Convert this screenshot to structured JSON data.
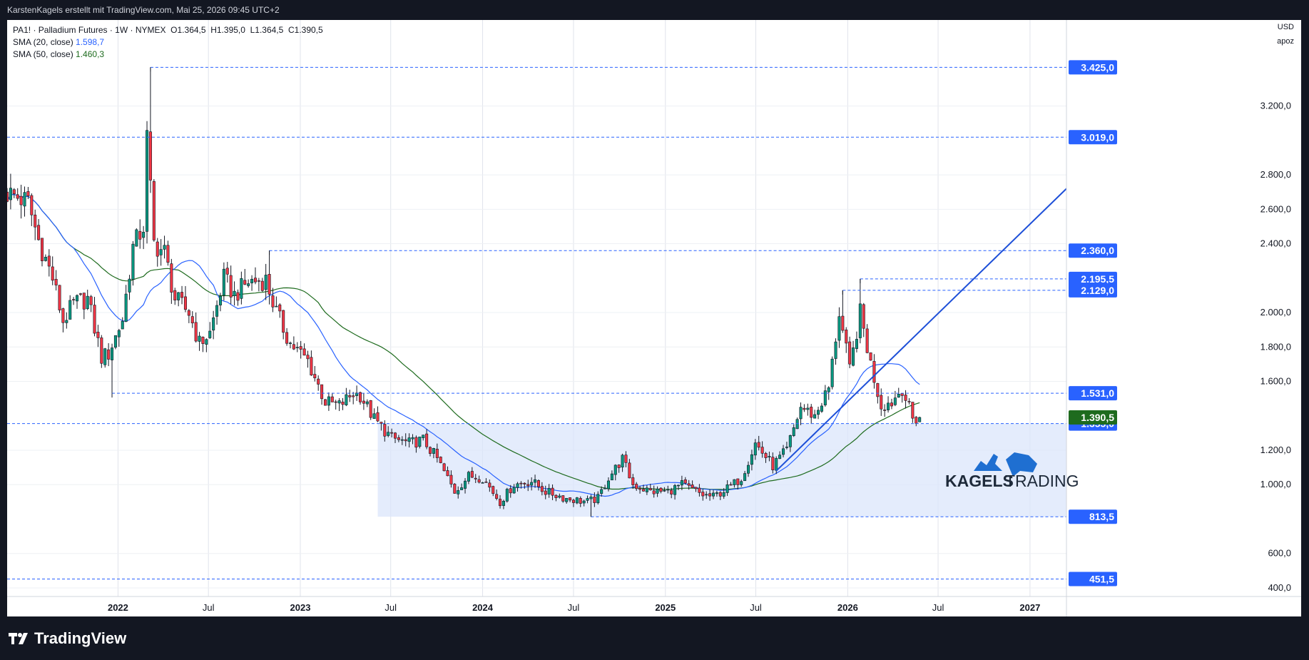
{
  "header": {
    "attribution": "KarstenKagels erstellt mit TradingView.com, Mai 25, 2026 09:45 UTC+2"
  },
  "legend": {
    "title": "PA1! · Palladium Futures · 1W · NYMEX",
    "open": "O1.364,5",
    "high": "H1.395,0",
    "low": "L1.364,5",
    "close": "C1.390,5",
    "sma20_label": "SMA (20, close)",
    "sma20_value": "1.598,7",
    "sma50_label": "SMA (50, close)",
    "sma50_value": "1.460,3"
  },
  "axis_meta": {
    "currency": "USD",
    "mode": "apoz"
  },
  "footer": {
    "brand": "TradingView"
  },
  "watermark": {
    "text1": "KAGELS",
    "text2": "TRADING"
  },
  "colors": {
    "up": "#089981",
    "down": "#f23645",
    "sma20": "#2962ff",
    "sma50": "#1e6b1e",
    "level_line": "#2962ff",
    "zone_fill": "#dbe6fb",
    "badge": "#2962ff",
    "close_badge": "#1e6b1e"
  },
  "chart_data": {
    "type": "candlestick",
    "symbol": "PA1!",
    "timeframe": "1W",
    "x_ticks": [
      {
        "label": "2022",
        "date": "2022-01-01",
        "bold": true
      },
      {
        "label": "Jul",
        "date": "2022-07-01",
        "bold": false
      },
      {
        "label": "2023",
        "date": "2023-01-01",
        "bold": true
      },
      {
        "label": "Jul",
        "date": "2023-07-01",
        "bold": false
      },
      {
        "label": "2024",
        "date": "2024-01-01",
        "bold": true
      },
      {
        "label": "Jul",
        "date": "2024-07-01",
        "bold": false
      },
      {
        "label": "2025",
        "date": "2025-01-01",
        "bold": true
      },
      {
        "label": "Jul",
        "date": "2025-07-01",
        "bold": false
      },
      {
        "label": "2026",
        "date": "2026-01-01",
        "bold": true
      },
      {
        "label": "Jul",
        "date": "2026-07-01",
        "bold": false
      },
      {
        "label": "2027",
        "date": "2027-01-01",
        "bold": true
      }
    ],
    "x_range": [
      "2021-05-24",
      "2027-03-15"
    ],
    "y_ticks": [
      {
        "label": "3.200,0",
        "value": 3200
      },
      {
        "label": "2.800,0",
        "value": 2800
      },
      {
        "label": "2.600,0",
        "value": 2600
      },
      {
        "label": "2.400,0",
        "value": 2400
      },
      {
        "label": "2.000,0",
        "value": 2000
      },
      {
        "label": "1.800,0",
        "value": 1800
      },
      {
        "label": "1.600,0",
        "value": 1600
      },
      {
        "label": "1.200,0",
        "value": 1200
      },
      {
        "label": "1.000,0",
        "value": 1000
      },
      {
        "label": "600,0",
        "value": 600
      },
      {
        "label": "400,0",
        "value": 400
      }
    ],
    "y_range": [
      350,
      3700
    ],
    "levels": [
      {
        "label": "3.425,0",
        "value": 3425,
        "from": "2022-03-07"
      },
      {
        "label": "3.019,0",
        "value": 3019,
        "from": "2021-05-24"
      },
      {
        "label": "2.360,0",
        "value": 2360,
        "from": "2022-10-31"
      },
      {
        "label": "2.195,5",
        "value": 2195.5,
        "from": "2026-01-26"
      },
      {
        "label": "2.129,0",
        "value": 2129,
        "from": "2025-12-22"
      },
      {
        "label": "1.531,0",
        "value": 1531,
        "from": "2021-12-20"
      },
      {
        "label": "1.355,0",
        "value": 1355,
        "from": "2021-05-24"
      },
      {
        "label": "813,5",
        "value": 813.5,
        "from": "2024-08-05"
      },
      {
        "label": "451,5",
        "value": 451.5,
        "from": "2021-05-24"
      }
    ],
    "current_price": {
      "label": "1.390,5",
      "value": 1390.5
    },
    "zone": {
      "from": "2023-06-05",
      "to": "2027-03-15",
      "low": 813.5,
      "high": 1355
    },
    "trendline": {
      "from_date": "2025-08-11",
      "from_value": 1080,
      "to_date": "2027-03-15",
      "to_value": 2720
    },
    "anchors": [
      [
        "2021-05-24",
        2700
      ],
      [
        "2021-06-14",
        2680
      ],
      [
        "2021-07-12",
        2640
      ],
      [
        "2021-08-02",
        2420
      ],
      [
        "2021-08-30",
        2200
      ],
      [
        "2021-09-20",
        1950
      ],
      [
        "2021-10-11",
        2050
      ],
      [
        "2021-11-08",
        2080
      ],
      [
        "2021-12-06",
        1740
      ],
      [
        "2021-12-20",
        1760
      ],
      [
        "2022-01-17",
        1960
      ],
      [
        "2022-02-07",
        2380
      ],
      [
        "2022-02-28",
        2500
      ],
      [
        "2022-03-07",
        3019
      ],
      [
        "2022-03-21",
        2400
      ],
      [
        "2022-04-11",
        2350
      ],
      [
        "2022-05-02",
        2080
      ],
      [
        "2022-05-30",
        2000
      ],
      [
        "2022-06-20",
        1820
      ],
      [
        "2022-07-11",
        1880
      ],
      [
        "2022-08-08",
        2200
      ],
      [
        "2022-08-29",
        2100
      ],
      [
        "2022-09-26",
        2180
      ],
      [
        "2022-10-31",
        2190
      ],
      [
        "2022-11-21",
        2000
      ],
      [
        "2022-12-19",
        1820
      ],
      [
        "2023-01-23",
        1720
      ],
      [
        "2023-02-27",
        1480
      ],
      [
        "2023-03-27",
        1460
      ],
      [
        "2023-04-24",
        1530
      ],
      [
        "2023-05-08",
        1520
      ],
      [
        "2023-06-05",
        1380
      ],
      [
        "2023-07-10",
        1270
      ],
      [
        "2023-08-14",
        1240
      ],
      [
        "2023-09-11",
        1260
      ],
      [
        "2023-10-09",
        1150
      ],
      [
        "2023-11-13",
        960
      ],
      [
        "2023-12-11",
        1050
      ],
      [
        "2024-01-08",
        1040
      ],
      [
        "2024-02-12",
        900
      ],
      [
        "2024-03-11",
        1000
      ],
      [
        "2024-04-15",
        1020
      ],
      [
        "2024-05-13",
        960
      ],
      [
        "2024-06-24",
        920
      ],
      [
        "2024-08-05",
        900
      ],
      [
        "2024-08-26",
        920
      ],
      [
        "2024-09-16",
        1040
      ],
      [
        "2024-10-14",
        1150
      ],
      [
        "2024-11-04",
        1000
      ],
      [
        "2024-12-09",
        960
      ],
      [
        "2025-01-13",
        960
      ],
      [
        "2025-02-10",
        1000
      ],
      [
        "2025-03-24",
        940
      ],
      [
        "2025-04-14",
        930
      ],
      [
        "2025-05-19",
        990
      ],
      [
        "2025-06-09",
        1040
      ],
      [
        "2025-07-07",
        1240
      ],
      [
        "2025-08-11",
        1110
      ],
      [
        "2025-09-08",
        1200
      ],
      [
        "2025-10-06",
        1450
      ],
      [
        "2025-11-03",
        1400
      ],
      [
        "2025-12-01",
        1560
      ],
      [
        "2025-12-22",
        2000
      ],
      [
        "2026-01-12",
        1660
      ],
      [
        "2026-02-02",
        2000
      ],
      [
        "2026-02-23",
        1700
      ],
      [
        "2026-03-16",
        1460
      ],
      [
        "2026-04-06",
        1480
      ],
      [
        "2026-04-27",
        1560
      ],
      [
        "2026-05-18",
        1380
      ]
    ],
    "last_candle": {
      "date": "2026-05-25",
      "open": 1364.5,
      "high": 1395.0,
      "low": 1364.5,
      "close": 1390.5
    }
  }
}
